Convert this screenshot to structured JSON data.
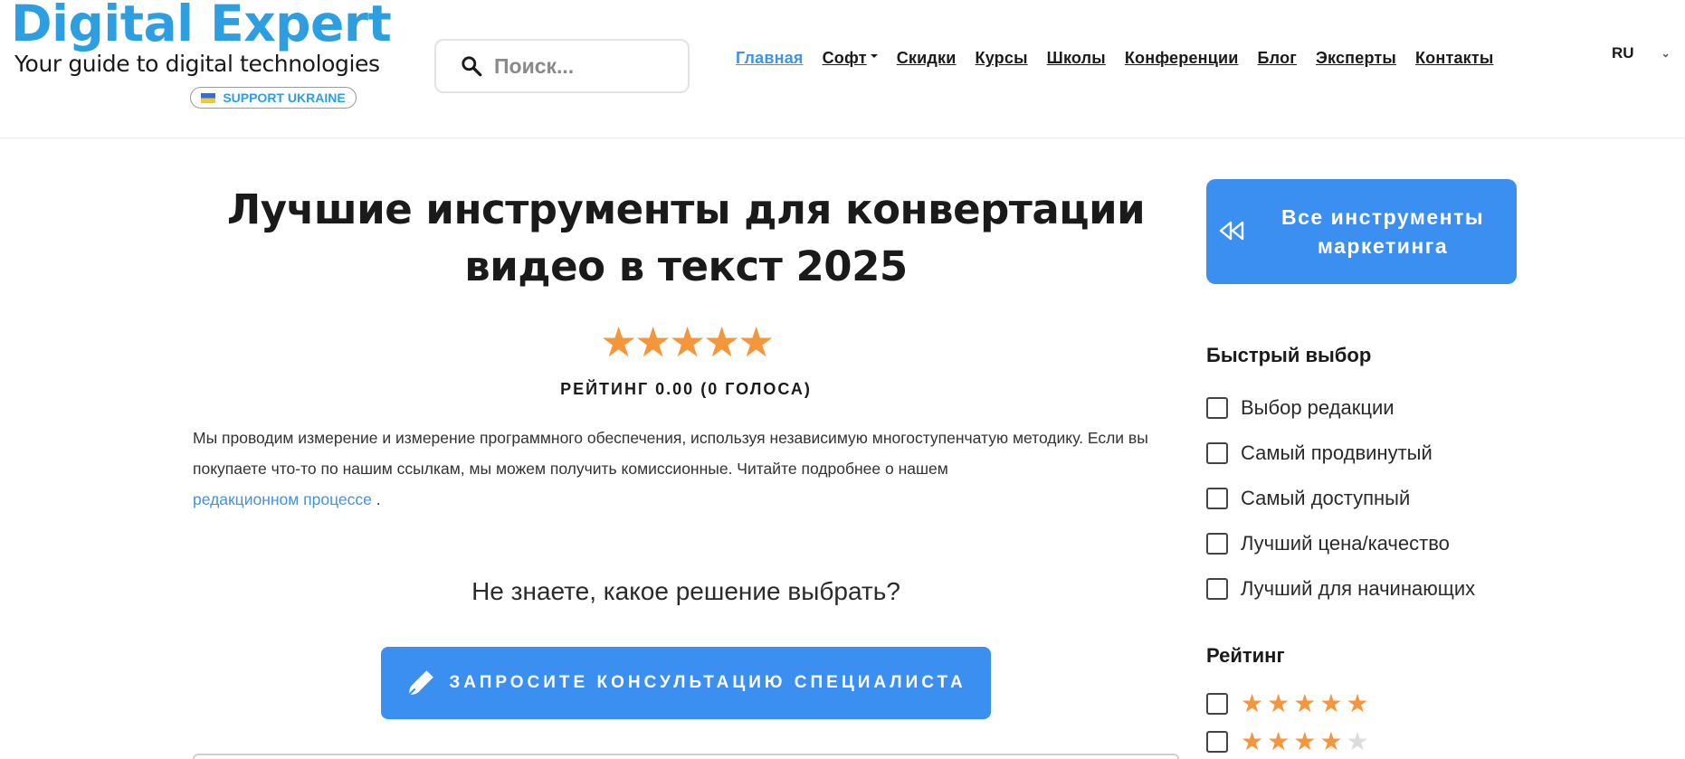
{
  "header": {
    "logo_title": "Digital Expert",
    "logo_tagline": "Your guide to digital technologies",
    "ukraine_badge": "SUPPORT UKRAINE",
    "search_placeholder": "Поиск...",
    "nav": [
      {
        "label": "Главная",
        "active": true
      },
      {
        "label": "Софт",
        "dropdown": true
      },
      {
        "label": "Скидки"
      },
      {
        "label": "Курсы"
      },
      {
        "label": "Школы"
      },
      {
        "label": "Конференции"
      },
      {
        "label": "Блог"
      },
      {
        "label": "Эксперты"
      },
      {
        "label": "Контакты"
      }
    ],
    "language": "RU"
  },
  "main": {
    "title_line1": "Лучшие инструменты для конвертации",
    "title_line2": "видео в текст 2025",
    "rating_stars": 5,
    "rating_text": "РЕЙТИНГ 0.00 (0 ГОЛОСА)",
    "disclaimer_text": "Мы проводим измерение и измерение программного обеспечения, используя независимую многоступенчатую методику. Если вы покупаете что-то по нашим ссылкам, мы можем получить комиссионные. Читайте подробнее о нашем",
    "disclaimer_link": "редакционном процессе",
    "disclaimer_end": " .",
    "question": "Не знаете, какое решение выбрать?",
    "consult_button": "ЗАПРОСИТЕ КОНСУЛЬТАЦИЮ СПЕЦИАЛИСТА"
  },
  "sidebar": {
    "all_tools_line1": "Все инструменты",
    "all_tools_line2": "маркетинга",
    "quick_choice_heading": "Быстрый выбор",
    "quick_choice": [
      "Выбор редакции",
      "Самый продвинутый",
      "Самый доступный",
      "Лучший цена/качество",
      "Лучший для начинающих"
    ],
    "rating_heading": "Рейтинг",
    "rating_filters": [
      {
        "filled": 5,
        "total": 5
      },
      {
        "filled": 4,
        "total": 5
      }
    ]
  },
  "colors": {
    "brand_blue": "#2d9fe0",
    "button_blue": "#3b8ff0",
    "link_blue": "#3f94e4",
    "star_orange": "#f3963c"
  }
}
